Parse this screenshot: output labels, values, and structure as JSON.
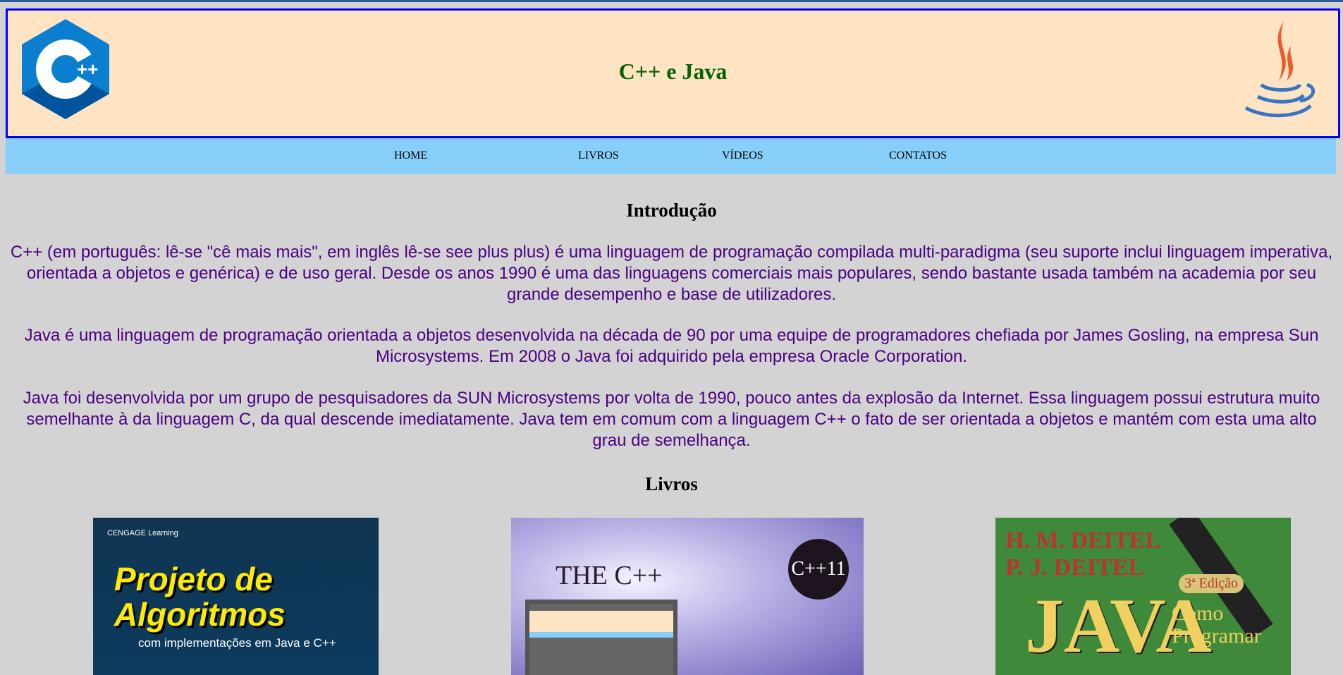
{
  "header": {
    "title": "C++ e Java",
    "left_logo": "cpp-logo",
    "right_logo": "java-logo"
  },
  "nav": {
    "items": [
      {
        "label": "HOME"
      },
      {
        "label": "LIVROS"
      },
      {
        "label": "VÍDEOS"
      },
      {
        "label": "CONTATOS"
      }
    ]
  },
  "intro": {
    "heading": "Introdução",
    "paragraphs": [
      "C++ (em português: lê-se \"cê mais mais\", em inglês lê-se see plus plus) é uma linguagem de programação compilada multi-paradigma (seu suporte inclui linguagem imperativa, orientada a objetos e genérica) e de uso geral. Desde os anos 1990 é uma das linguagens comerciais mais populares, sendo bastante usada também na academia por seu grande desempenho e base de utilizadores.",
      "Java é uma linguagem de programação orientada a objetos desenvolvida na década de 90 por uma equipe de programadores chefiada por James Gosling, na empresa Sun Microsystems. Em 2008 o Java foi adquirido pela empresa Oracle Corporation.",
      "Java foi desenvolvida por um grupo de pesquisadores da SUN Microsystems por volta de 1990, pouco antes da explosão da Internet. Essa linguagem possui estrutura muito semelhante à da linguagem C, da qual descende imediatamente. Java tem em comum com a linguagem C++ o fato de ser orientada a objetos e mantém com esta uma alto grau de semelhança."
    ]
  },
  "books": {
    "heading": "Livros",
    "items": [
      {
        "publisher": "CENGAGE Learning",
        "title": "Projeto de Algoritmos",
        "subtitle": "com implementações em Java e C++"
      },
      {
        "title": "THE C++",
        "badge": "C++11"
      },
      {
        "authors": "H. M. DEITEL P. J. DEITEL",
        "title": "JAVA",
        "subtitle": "Como Programar",
        "edition": "3ª Edição"
      }
    ]
  },
  "colors": {
    "header_bg": "#ffe4c4",
    "header_border": "#0000ff",
    "nav_bg": "#87cefa",
    "title": "#006400",
    "text": "#4b0082",
    "page_bg": "#d3d3d3"
  }
}
